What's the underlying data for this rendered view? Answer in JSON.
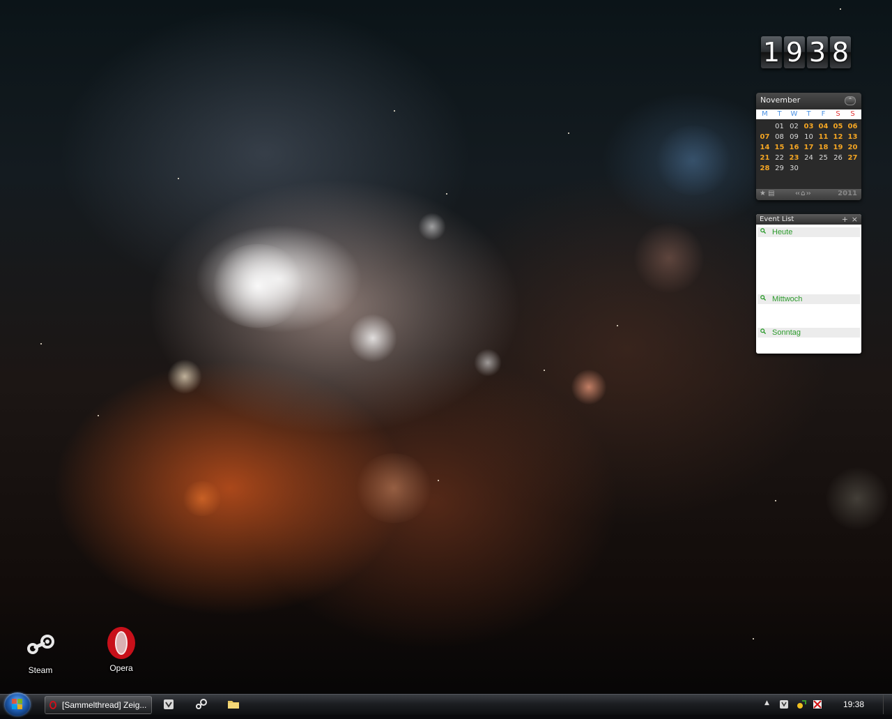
{
  "desktop": {
    "icons": [
      {
        "label": "Steam"
      },
      {
        "label": "Opera"
      }
    ]
  },
  "flipclock": {
    "digits": [
      "1",
      "9",
      "3",
      "8"
    ]
  },
  "calendar": {
    "month": "November",
    "year": "2011",
    "weekdays": [
      "M",
      "T",
      "W",
      "T",
      "F",
      "S",
      "S"
    ],
    "weeks": [
      [
        "",
        "01",
        "02",
        "03",
        "04",
        "05",
        "06"
      ],
      [
        "07",
        "08",
        "09",
        "10",
        "11",
        "12",
        "13"
      ],
      [
        "14",
        "15",
        "16",
        "17",
        "18",
        "19",
        "20"
      ],
      [
        "21",
        "22",
        "23",
        "24",
        "25",
        "26",
        "27"
      ],
      [
        "28",
        "29",
        "30",
        "",
        "",
        "",
        ""
      ]
    ],
    "highlighted_days": [
      "03",
      "04",
      "05",
      "06",
      "07",
      "11",
      "12",
      "13",
      "14",
      "15",
      "16",
      "17",
      "18",
      "19",
      "20",
      "21",
      "23",
      "27",
      "28"
    ],
    "colors": {
      "highlight": "#f5a623",
      "weekday_header": "#4a90e2",
      "weekend_header": "#e03030"
    }
  },
  "eventlist": {
    "title": "Event List",
    "add_symbol": "+",
    "close_symbol": "×",
    "sections": [
      "Heute",
      "Mittwoch",
      "Sonntag"
    ]
  },
  "taskbar": {
    "start_icon": "windows-orb-icon",
    "window_button": {
      "label": "[Sammelthread] Zeig...",
      "icon": "opera-icon"
    },
    "quicklaunch": [
      "app-icon-1",
      "steam-icon",
      "folder-icon"
    ],
    "tray": {
      "expand_symbol": "▲",
      "icons": [
        "tray-app-icon",
        "network-icon",
        "security-icon"
      ]
    },
    "clock": "19:38"
  }
}
